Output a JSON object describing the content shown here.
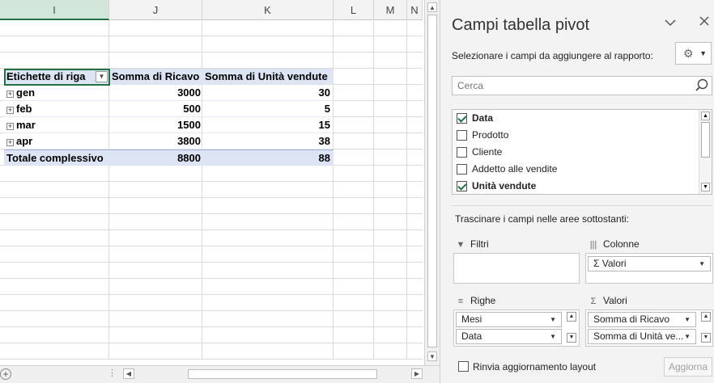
{
  "sheet": {
    "columns": [
      {
        "label": "I",
        "selected": true
      },
      {
        "label": "J",
        "selected": false
      },
      {
        "label": "K",
        "selected": false
      },
      {
        "label": "L",
        "selected": false
      },
      {
        "label": "M",
        "selected": false
      },
      {
        "label": "N",
        "selected": false
      }
    ],
    "pivot": {
      "header": {
        "row_labels": "Etichette di riga",
        "col1": "Somma di  Ricavo",
        "col2": "Somma di Unità vendute"
      },
      "rows": [
        {
          "label": "gen",
          "ricavo": "3000",
          "unita": "30"
        },
        {
          "label": "feb",
          "ricavo": "500",
          "unita": "5"
        },
        {
          "label": "mar",
          "ricavo": "1500",
          "unita": "15"
        },
        {
          "label": "apr",
          "ricavo": "3800",
          "unita": "38"
        }
      ],
      "total": {
        "label": "Totale complessivo",
        "ricavo": "8800",
        "unita": "88"
      }
    }
  },
  "pane": {
    "title": "Campi tabella pivot",
    "subtitle": "Selezionare i campi da aggiungere al rapporto:",
    "search_placeholder": "Cerca",
    "fields": [
      {
        "label": "Data",
        "checked": true
      },
      {
        "label": "Prodotto",
        "checked": false
      },
      {
        "label": "Cliente",
        "checked": false
      },
      {
        "label": "Addetto alle vendite",
        "checked": false
      },
      {
        "label": "Unità vendute",
        "checked": true
      }
    ],
    "drag_label": "Trascinare i campi nelle aree sottostanti:",
    "areas": {
      "filters": {
        "label": "Filtri",
        "items": []
      },
      "columns": {
        "label": "Colonne",
        "items": [
          "Σ  Valori"
        ]
      },
      "rows": {
        "label": "Righe",
        "items": [
          "Mesi",
          "Data"
        ]
      },
      "values": {
        "label": "Valori",
        "items": [
          "Somma di  Ricavo",
          "Somma di Unità ve..."
        ]
      }
    },
    "defer_label": "Rinvia aggiornamento layout",
    "update_label": "Aggiorna",
    "accent_color": "#217346"
  }
}
